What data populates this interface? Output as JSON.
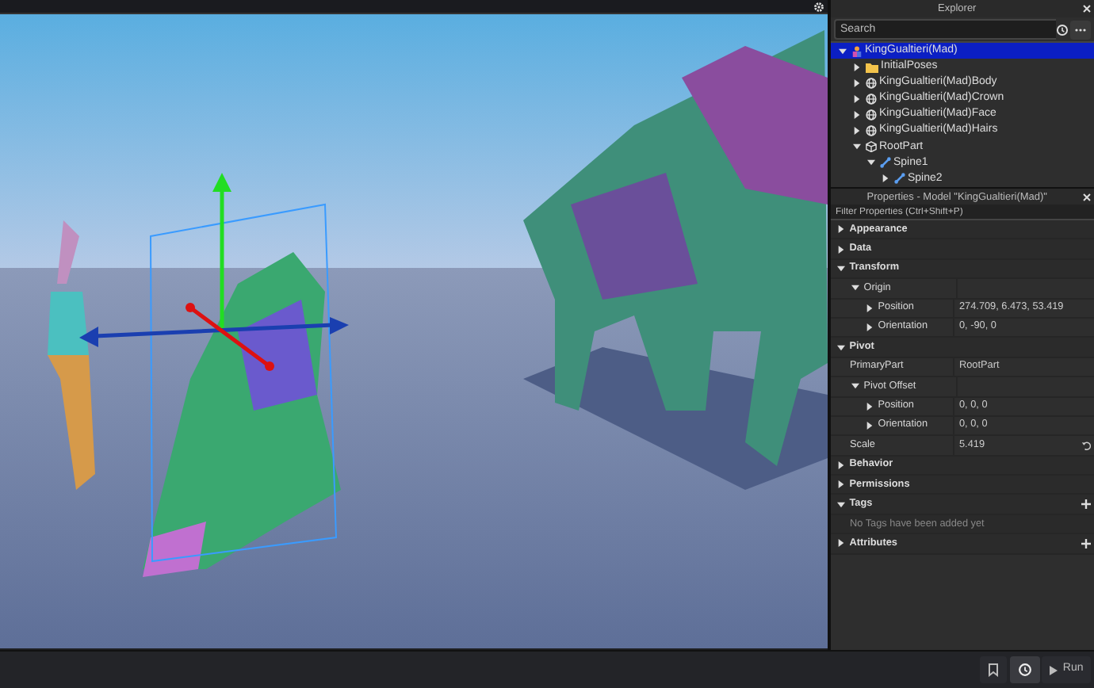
{
  "explorer": {
    "title": "Explorer",
    "search": {
      "placeholder": "Search"
    },
    "tree": [
      {
        "label": "KingGualtieri(Mad)",
        "kind": "model",
        "expanded": true,
        "selected": true,
        "children": [
          {
            "label": "InitialPoses",
            "kind": "folder",
            "expanded": false,
            "selected": false
          },
          {
            "label": "KingGualtieri(Mad)Body",
            "kind": "mesh",
            "expanded": false,
            "selected": false
          },
          {
            "label": "KingGualtieri(Mad)Crown",
            "kind": "mesh",
            "expanded": false,
            "selected": false
          },
          {
            "label": "KingGualtieri(Mad)Face",
            "kind": "mesh",
            "expanded": false,
            "selected": false
          },
          {
            "label": "KingGualtieri(Mad)Hairs",
            "kind": "mesh",
            "expanded": false,
            "selected": false
          },
          {
            "label": "RootPart",
            "kind": "part",
            "expanded": true,
            "selected": false,
            "children": [
              {
                "label": "Spine1",
                "kind": "bone",
                "expanded": true,
                "selected": false,
                "children": [
                  {
                    "label": "Spine2",
                    "kind": "bone",
                    "expanded": false,
                    "selected": false
                  }
                ]
              }
            ]
          }
        ]
      }
    ]
  },
  "properties": {
    "title": "Properties - Model \"KingGualtieri(Mad)\"",
    "filter": {
      "placeholder": "Filter Properties (Ctrl+Shift+P)"
    },
    "rows": [
      {
        "kind": "category",
        "label": "Appearance",
        "expanded": false
      },
      {
        "kind": "category",
        "label": "Data",
        "expanded": false
      },
      {
        "kind": "category",
        "label": "Transform",
        "expanded": true,
        "children": [
          {
            "kind": "group",
            "label": "Origin",
            "expanded": true,
            "children": [
              {
                "kind": "property",
                "label": "Position",
                "value": "274.709, 6.473, 53.419",
                "expanded": false
              },
              {
                "kind": "property",
                "label": "Orientation",
                "value": "0, -90, 0",
                "expanded": false
              }
            ]
          }
        ]
      },
      {
        "kind": "category",
        "label": "Pivot",
        "expanded": true,
        "children": [
          {
            "kind": "field",
            "label": "PrimaryPart",
            "value": "RootPart"
          },
          {
            "kind": "group",
            "label": "Pivot Offset",
            "expanded": true,
            "children": [
              {
                "kind": "property",
                "label": "Position",
                "value": "0, 0, 0",
                "expanded": false
              },
              {
                "kind": "property",
                "label": "Orientation",
                "value": "0, 0, 0",
                "expanded": false
              }
            ]
          },
          {
            "kind": "field",
            "label": "Scale",
            "value": "5.419",
            "reset": true
          }
        ]
      },
      {
        "kind": "category",
        "label": "Behavior",
        "expanded": false
      },
      {
        "kind": "category",
        "label": "Permissions",
        "expanded": false
      },
      {
        "kind": "category",
        "label": "Tags",
        "expanded": true,
        "add": true,
        "children": [
          {
            "kind": "note",
            "label": "No Tags have been added yet"
          }
        ]
      },
      {
        "kind": "category",
        "label": "Attributes",
        "expanded": false,
        "add": true
      }
    ]
  },
  "toolbar": {
    "run": "Run"
  }
}
